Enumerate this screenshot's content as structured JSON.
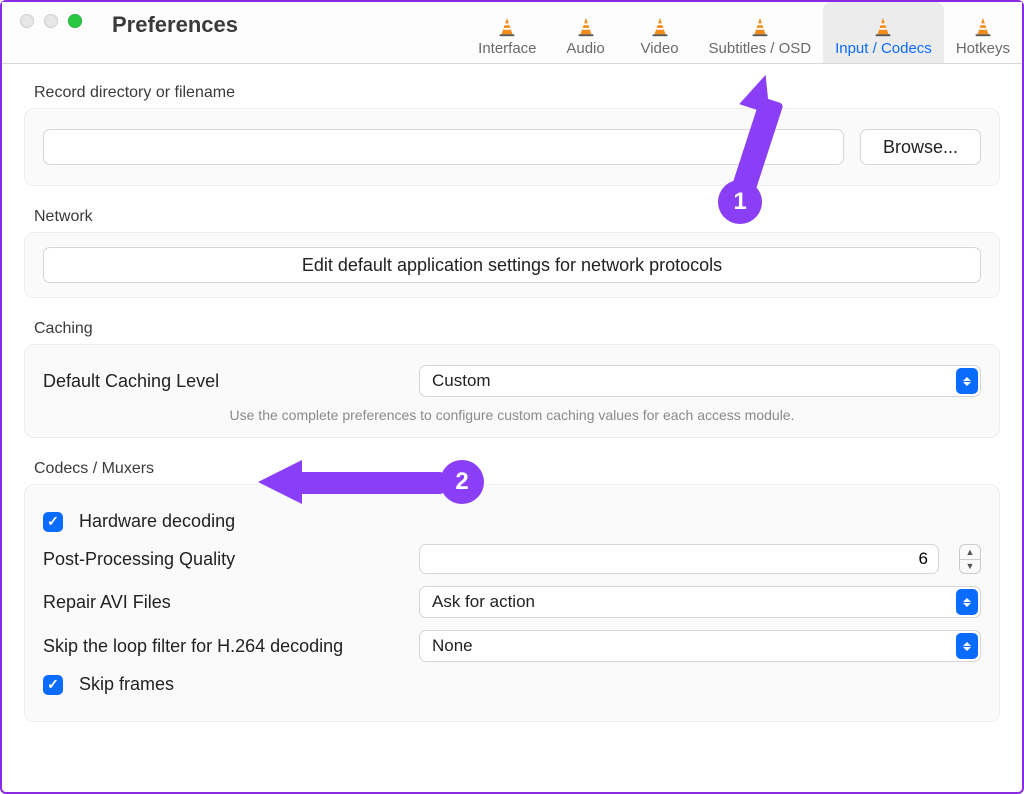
{
  "window": {
    "title": "Preferences"
  },
  "tabs": [
    {
      "label": "Interface"
    },
    {
      "label": "Audio"
    },
    {
      "label": "Video"
    },
    {
      "label": "Subtitles / OSD"
    },
    {
      "label": "Input / Codecs"
    },
    {
      "label": "Hotkeys"
    }
  ],
  "record": {
    "section": "Record directory or filename",
    "value": "",
    "browse": "Browse..."
  },
  "network": {
    "section": "Network",
    "button": "Edit default application settings for network protocols"
  },
  "caching": {
    "section": "Caching",
    "label": "Default Caching Level",
    "value": "Custom",
    "hint": "Use the complete preferences to configure custom caching values for each access module."
  },
  "codecs": {
    "section": "Codecs / Muxers",
    "hw_decoding": "Hardware decoding",
    "ppq_label": "Post-Processing Quality",
    "ppq_value": "6",
    "repair_label": "Repair AVI Files",
    "repair_value": "Ask for action",
    "loop_label": "Skip the loop filter for H.264 decoding",
    "loop_value": "None",
    "skipframes": "Skip frames"
  },
  "annotations": {
    "one": "1",
    "two": "2"
  }
}
